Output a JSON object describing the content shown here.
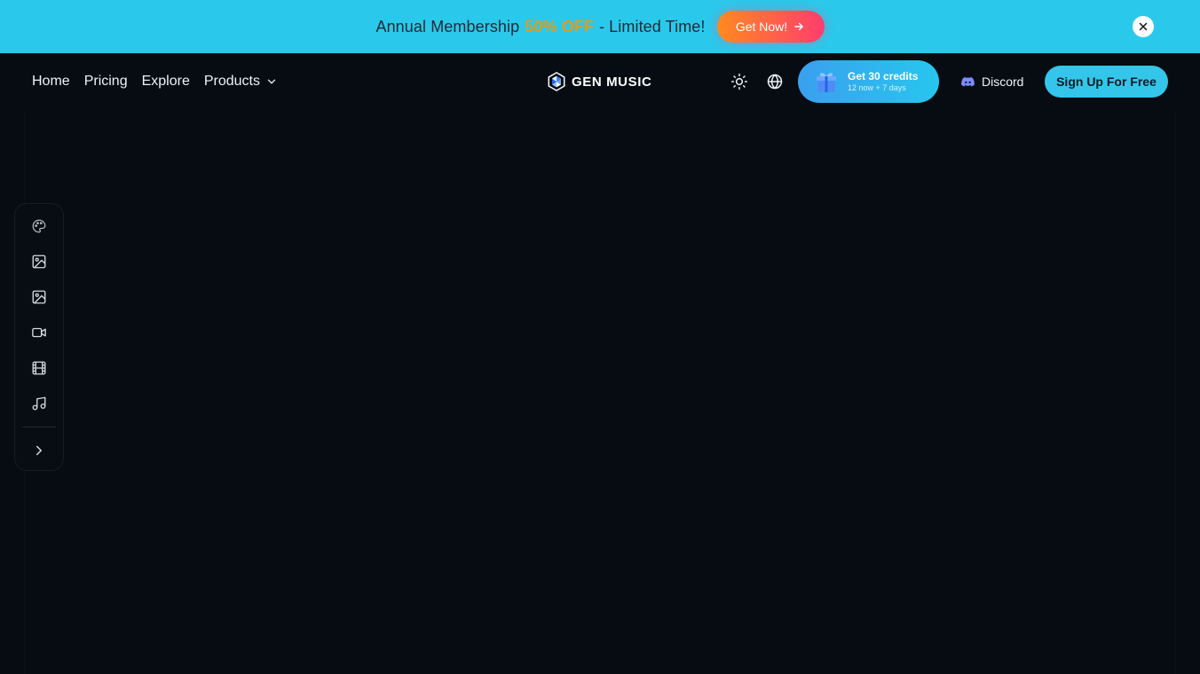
{
  "banner": {
    "prefix": "Annual Membership",
    "highlight": "50% OFF",
    "suffix": "- Limited Time!",
    "cta_label": "Get Now!",
    "highlight_color": "#e99a12",
    "background_color": "#2ac9ec"
  },
  "nav": {
    "links": [
      {
        "label": "Home"
      },
      {
        "label": "Pricing"
      },
      {
        "label": "Explore"
      },
      {
        "label": "Products"
      }
    ],
    "logo_text": "GEN MUSIC",
    "credits": {
      "title": "Get 30 credits",
      "subtitle": "12 now + 7 days"
    },
    "discord_label": "Discord",
    "signup_label": "Sign Up For Free"
  },
  "sidebar": {
    "items": [
      {
        "icon": "palette-icon"
      },
      {
        "icon": "image-icon"
      },
      {
        "icon": "image-edit-icon"
      },
      {
        "icon": "video-icon"
      },
      {
        "icon": "film-icon"
      },
      {
        "icon": "music-note-icon"
      }
    ],
    "expand_icon": "chevron-right-icon"
  },
  "colors": {
    "page_background": "#060c12",
    "accent": "#34c6ea",
    "cta_gradient_start": "#ff8a1f",
    "cta_gradient_end": "#ff3d6e"
  }
}
